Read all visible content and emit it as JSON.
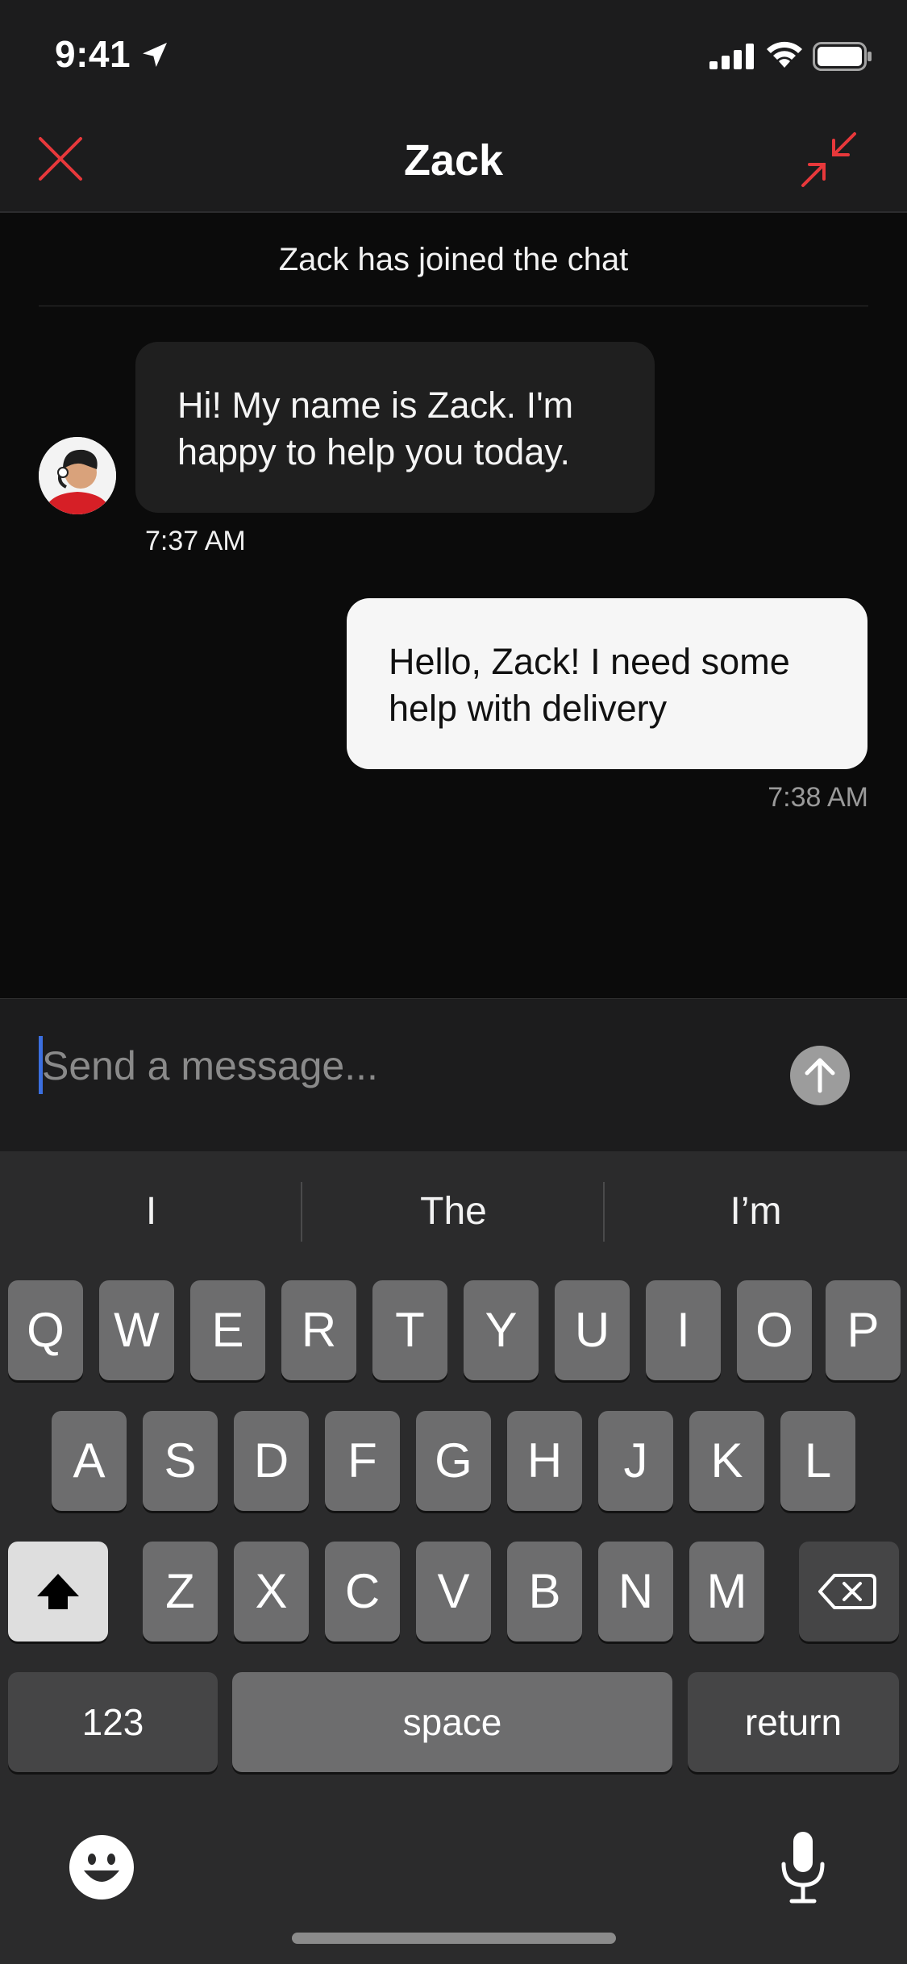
{
  "status_bar": {
    "time": "9:41"
  },
  "header": {
    "title": "Zack",
    "accent_color": "#e8383b"
  },
  "chat": {
    "system_message": "Zack has joined the chat",
    "messages": [
      {
        "sender": "agent",
        "text": "Hi! My name is Zack. I'm happy to help you today.",
        "time": "7:37 AM"
      },
      {
        "sender": "user",
        "text": "Hello, Zack! I need some help with delivery",
        "time": "7:38 AM"
      }
    ]
  },
  "composer": {
    "placeholder": "Send a message..."
  },
  "keyboard": {
    "suggestions": [
      "I",
      "The",
      "I’m"
    ],
    "row1": [
      "Q",
      "W",
      "E",
      "R",
      "T",
      "Y",
      "U",
      "I",
      "O",
      "P"
    ],
    "row2": [
      "A",
      "S",
      "D",
      "F",
      "G",
      "H",
      "J",
      "K",
      "L"
    ],
    "row3": [
      "Z",
      "X",
      "C",
      "V",
      "B",
      "N",
      "M"
    ],
    "numbers_label": "123",
    "space_label": "space",
    "return_label": "return"
  }
}
